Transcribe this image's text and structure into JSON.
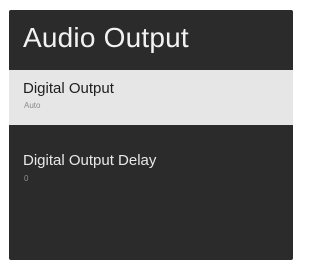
{
  "header": {
    "title": "Audio Output"
  },
  "settings": {
    "items": [
      {
        "label": "Digital Output",
        "value": "Auto"
      },
      {
        "label": "Digital Output Delay",
        "value": "0"
      }
    ]
  }
}
